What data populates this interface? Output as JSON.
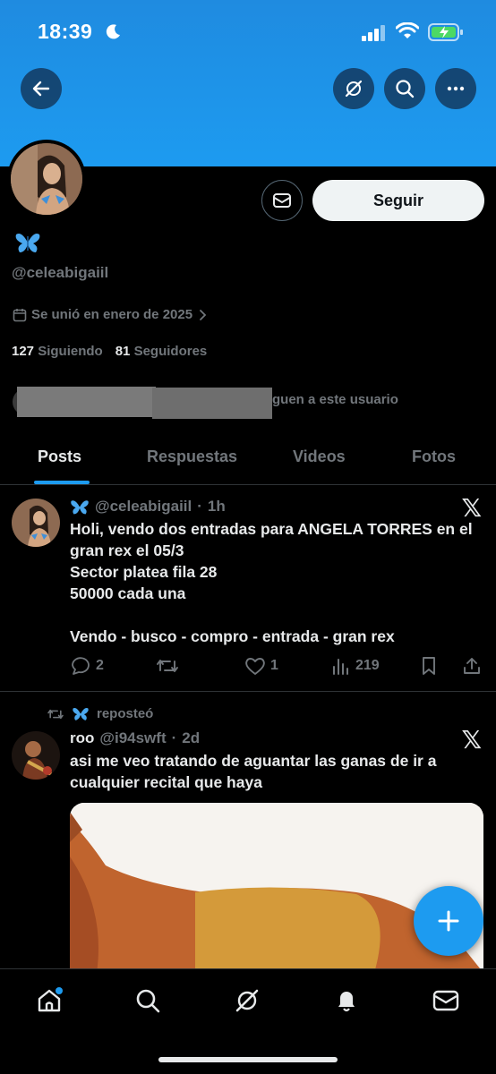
{
  "status_bar": {
    "time": "18:39"
  },
  "profile": {
    "handle": "@celeabigaiil",
    "joined": "Se unió en enero de 2025",
    "following_count": "127",
    "following_label": "Siguiendo",
    "followers_count": "81",
    "followers_label": "Seguidores",
    "followed_by_text": "guen a este usuario",
    "follow_button": "Seguir"
  },
  "tabs": [
    {
      "label": "Posts",
      "active": true
    },
    {
      "label": "Respuestas",
      "active": false
    },
    {
      "label": "Videos",
      "active": false
    },
    {
      "label": "Fotos",
      "active": false
    }
  ],
  "posts": [
    {
      "author_handle": "@celeabigaiil",
      "time": "1h",
      "text": "Holi, vendo dos entradas para ANGELA TORRES en el gran rex el 05/3\nSector platea fila 28\n50000 cada una\n\nVendo - busco - compro - entrada - gran rex",
      "replies": "2",
      "retweets": "",
      "likes": "1",
      "views": "219"
    },
    {
      "repost_label": "reposteó",
      "author_name": "roo",
      "author_handle": "@i94swft",
      "time": "2d",
      "text": "asi me veo tratando de aguantar las ganas de ir a cualquier recital que haya"
    }
  ],
  "colors": {
    "accent": "#1d9bf0",
    "background": "#000000",
    "muted": "#71767b",
    "text": "#e7e9ea"
  },
  "icons": [
    "back-arrow-icon",
    "grok-icon",
    "search-icon",
    "more-icon",
    "envelope-icon",
    "butterfly-icon",
    "calendar-icon",
    "chevron-right-icon",
    "x-logo-icon",
    "reply-icon",
    "retweet-icon",
    "like-icon",
    "views-icon",
    "bookmark-icon",
    "share-icon",
    "plus-icon",
    "home-icon",
    "bell-icon",
    "mail-icon"
  ]
}
